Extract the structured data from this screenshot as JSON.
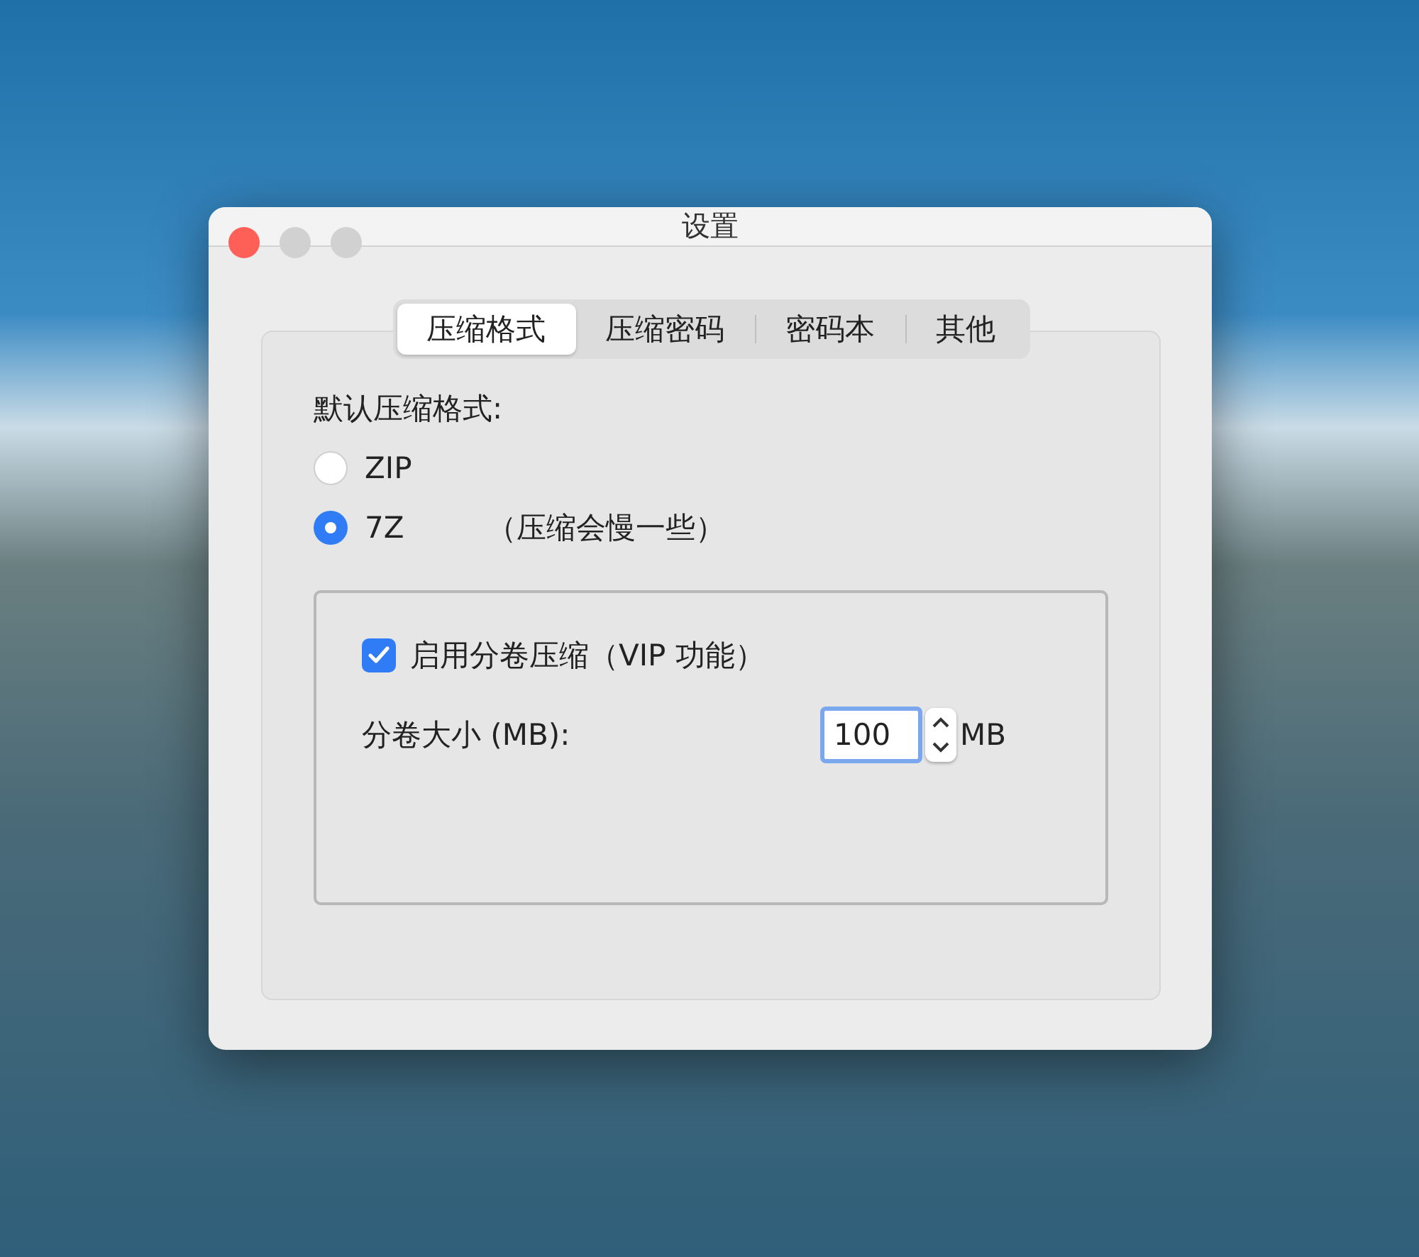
{
  "window": {
    "title": "设置"
  },
  "tabs": [
    {
      "label": "压缩格式",
      "selected": true
    },
    {
      "label": "压缩密码",
      "selected": false
    },
    {
      "label": "密码本",
      "selected": false
    },
    {
      "label": "其他",
      "selected": false
    }
  ],
  "format_label": "默认压缩格式:",
  "formats": [
    {
      "label": "ZIP",
      "selected": false
    },
    {
      "label": "7Z",
      "note": "（压缩会慢一些）",
      "selected": true
    }
  ],
  "split": {
    "label": "启用分卷压缩（VIP 功能）",
    "checked": true,
    "size_label": "分卷大小 (MB):",
    "value": "100",
    "unit": "MB"
  }
}
